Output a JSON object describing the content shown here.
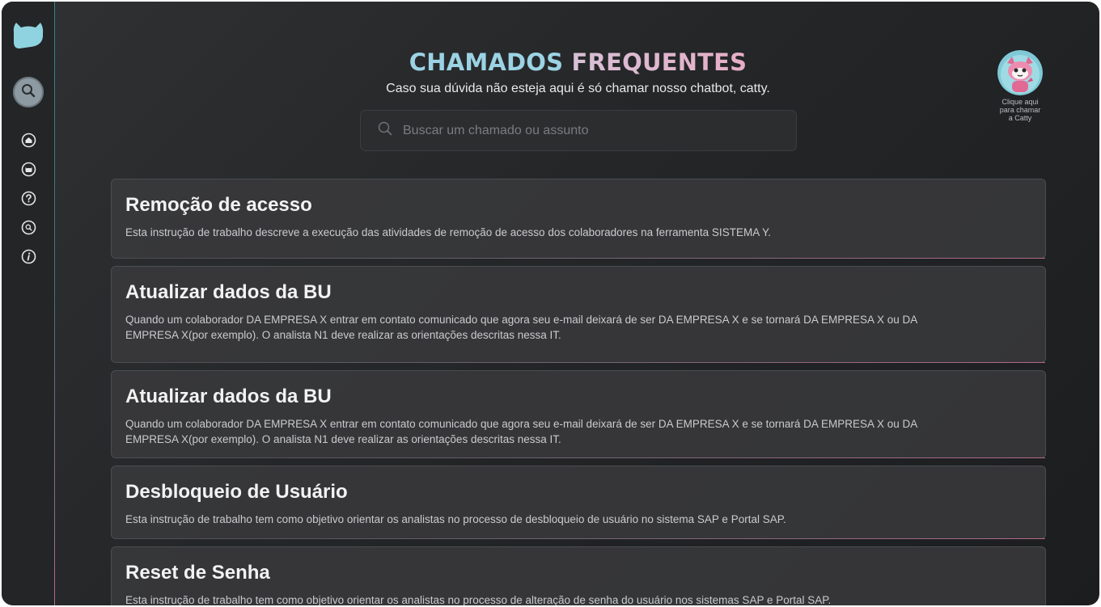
{
  "header": {
    "title_part1": "CHAMADOS",
    "title_part2": "FREQUENTES",
    "subtitle": "Caso sua dúvida não esteja aqui é só chamar nosso chatbot, catty."
  },
  "search": {
    "placeholder": "Buscar um chamado ou assunto",
    "value": ""
  },
  "sidebar": {
    "items": [
      {
        "name": "search",
        "icon": "search-icon"
      },
      {
        "name": "home",
        "icon": "home-icon"
      },
      {
        "name": "chatbot",
        "icon": "cat-icon"
      },
      {
        "name": "faq",
        "icon": "question-icon"
      },
      {
        "name": "search-tickets",
        "icon": "search-small-icon"
      },
      {
        "name": "info",
        "icon": "info-icon"
      }
    ]
  },
  "catty": {
    "label": "Clique aqui para chamar a Catty"
  },
  "cards": [
    {
      "title": "Remoção de acesso",
      "description": "Esta instrução de trabalho descreve a execução das atividades de remoção de acesso dos colaboradores na ferramenta SISTEMA Y."
    },
    {
      "title": "Atualizar dados da BU",
      "description": "Quando um colaborador DA EMPRESA X entrar em contato comunicado que agora seu e-mail deixará de ser DA EMPRESA X e se tornará DA EMPRESA X ou DA EMPRESA X(por exemplo). O analista N1 deve realizar as orientações descritas nessa IT."
    },
    {
      "title": "Atualizar dados da BU",
      "description": "Quando um colaborador DA EMPRESA X entrar em contato comunicado que agora seu e-mail deixará de ser DA EMPRESA X e se tornará DA EMPRESA X ou DA EMPRESA X(por exemplo). O analista N1 deve realizar as orientações descritas nessa IT."
    },
    {
      "title": "Desbloqueio de Usuário",
      "description": "Esta instrução de trabalho tem como objetivo orientar os analistas no processo de desbloqueio de usuário no sistema SAP e Portal SAP."
    },
    {
      "title": "Reset de Senha",
      "description": "Esta instrução de trabalho tem como objetivo orientar os analistas no processo de alteração de senha do usuário nos sistemas SAP e Portal SAP."
    }
  ],
  "colors": {
    "accent_blue": "#9bd3e4",
    "accent_pink": "#e7aec6",
    "brand_teal": "#8fd3e0",
    "background": "#262729"
  }
}
